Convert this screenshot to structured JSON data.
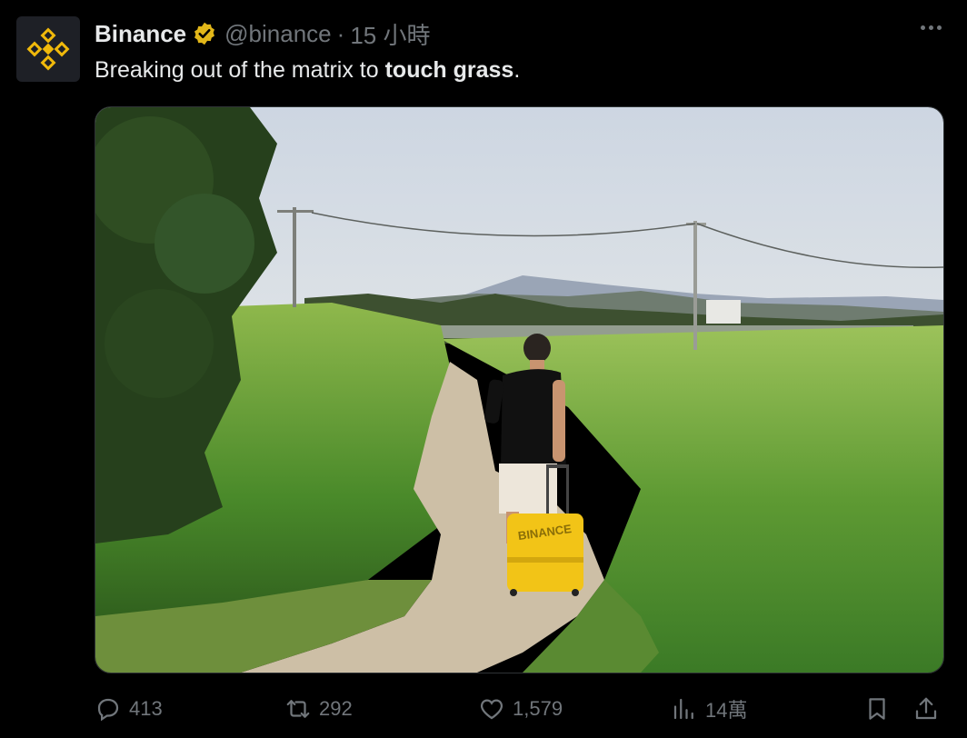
{
  "tweet": {
    "author_name": "Binance",
    "handle": "@binance",
    "separator": "·",
    "time": "15 小時",
    "text_prefix": "Breaking out of the matrix to ",
    "text_bold": "touch grass",
    "text_suffix": ".",
    "media_luggage_text": "BINANCE"
  },
  "actions": {
    "replies": "413",
    "reposts": "292",
    "likes": "1,579",
    "views": "14萬"
  },
  "colors": {
    "background": "#000000",
    "text_primary": "#e7e9ea",
    "text_secondary": "#71767b",
    "verified_badge": "#e2b719",
    "brand_yellow": "#f0b90b"
  },
  "icons": [
    "binance-logo-icon",
    "verified-badge-icon",
    "more-options-icon",
    "reply-icon",
    "repost-icon",
    "like-icon",
    "views-icon",
    "bookmark-icon",
    "share-icon"
  ]
}
